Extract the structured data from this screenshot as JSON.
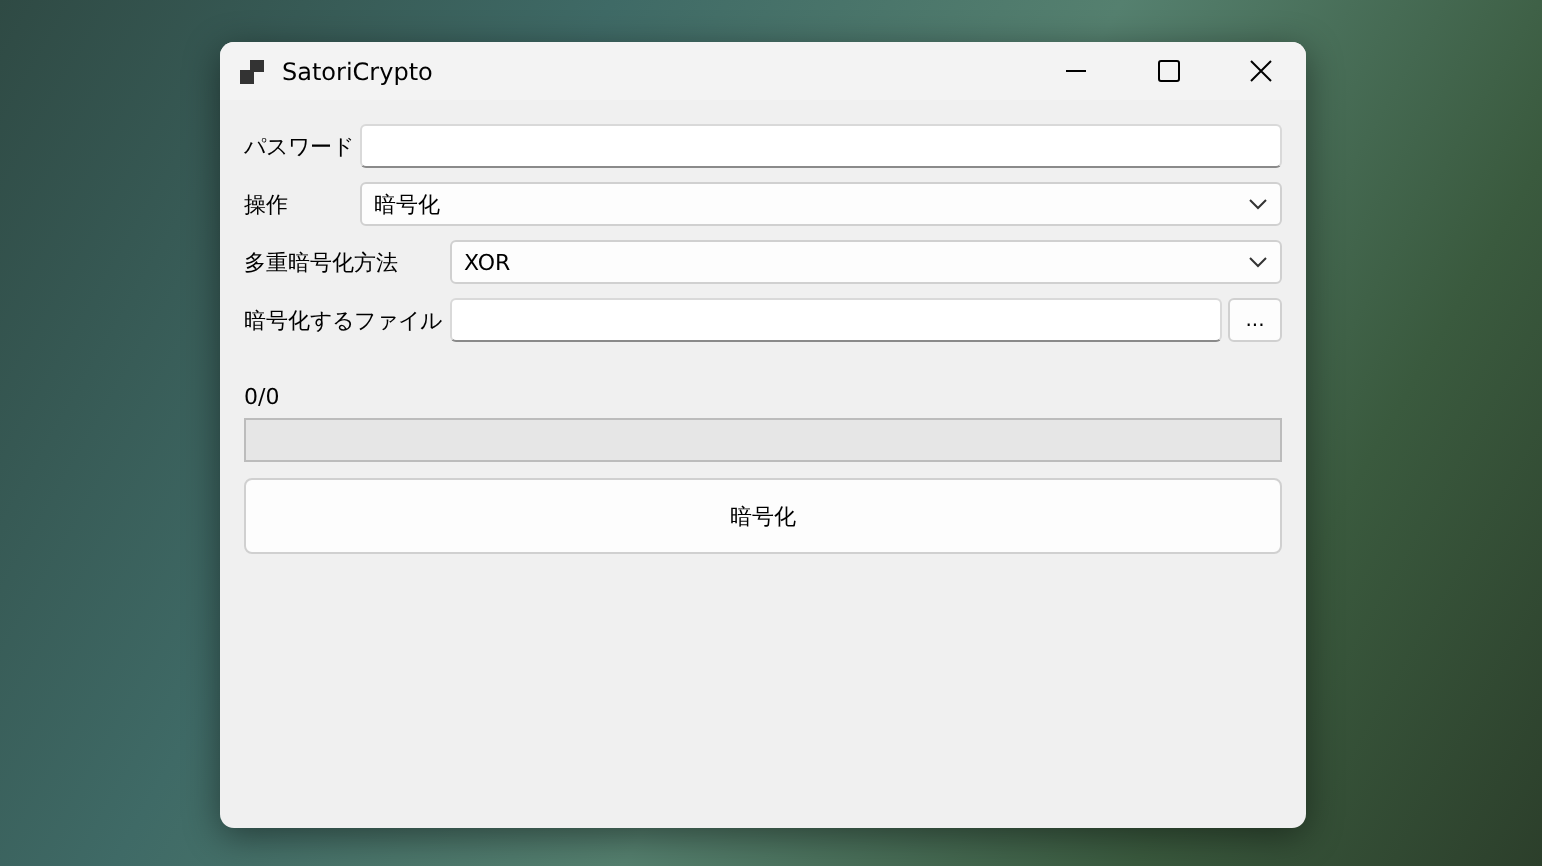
{
  "window": {
    "title": "SatoriCrypto"
  },
  "password": {
    "label": "パスワード"
  },
  "operation": {
    "label": "操作",
    "value": "暗号化"
  },
  "method": {
    "label": "多重暗号化方法",
    "value": "XOR"
  },
  "file": {
    "label": "暗号化するファイル",
    "browse": "..."
  },
  "progress": {
    "text": "0/0",
    "level": 0
  },
  "action_button": "暗号化"
}
